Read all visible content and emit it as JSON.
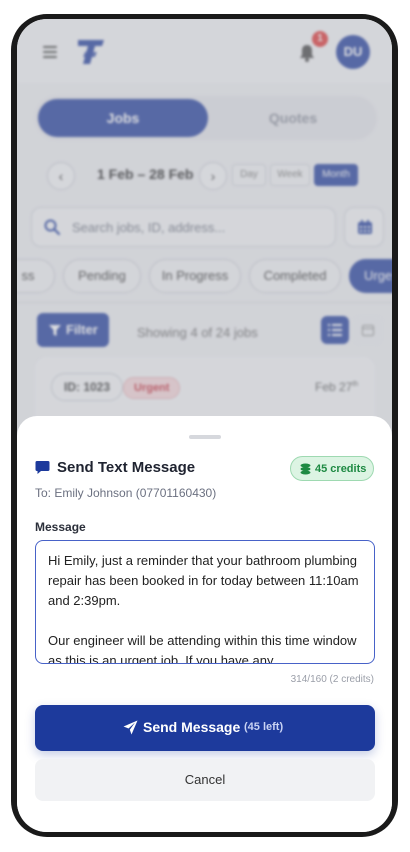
{
  "header": {
    "notification_count": "1",
    "avatar_initials": "DU"
  },
  "tabs": {
    "jobs": "Jobs",
    "quotes": "Quotes"
  },
  "date_nav": {
    "prev": "‹",
    "next": "›",
    "range": "1 Feb – 28 Feb",
    "periods": [
      "Day",
      "Week",
      "Month"
    ],
    "active_period": "Month"
  },
  "search": {
    "placeholder": "Search jobs, ID, address..."
  },
  "chips": [
    "ss",
    "Pending",
    "In Progress",
    "Completed",
    "Urge"
  ],
  "filter": {
    "label": "Filter",
    "showing": "Showing 4 of 24 jobs"
  },
  "job": {
    "id": "ID: 1023",
    "badge": "Urgent",
    "date": "Feb 27",
    "date_suffix": "th"
  },
  "sheet": {
    "title": "Send Text Message",
    "credits": "45 credits",
    "to": "To: Emily Johnson (07701160430)",
    "message_label": "Message",
    "message": "Hi Emily, just a reminder that your bathroom plumbing repair has been booked in for today between 11:10am and 2:39pm.\n\nOur engineer will be attending within this time window as this is an urgent job. If you have any",
    "char_count": "314/160 (2 credits)",
    "send_label": "Send Message",
    "send_left": "(45 left)",
    "cancel_label": "Cancel"
  },
  "colors": {
    "brand": "#1d3a9c",
    "urgent": "#c62e3c",
    "credits_green": "#1e8a43"
  }
}
